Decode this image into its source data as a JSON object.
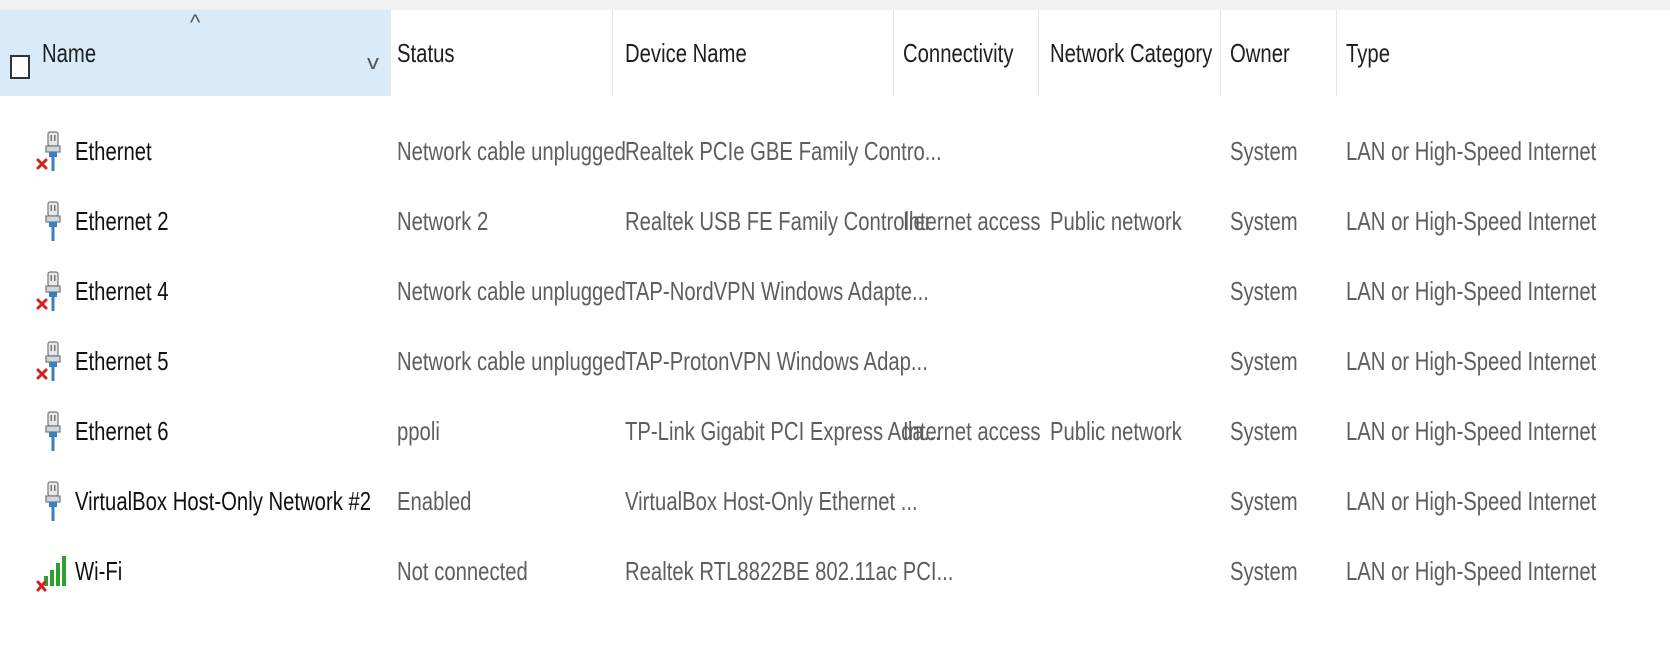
{
  "columns": {
    "name": "Name",
    "status": "Status",
    "device_name": "Device Name",
    "connectivity": "Connectivity",
    "network_category": "Network Category",
    "owner": "Owner",
    "type": "Type"
  },
  "sort_indicator": "^",
  "dropdown_indicator": "v",
  "rows": [
    {
      "name": "Ethernet",
      "status": "Network cable unplugged",
      "device_name": "Realtek PCIe GBE Family Contro...",
      "connectivity": "",
      "network_category": "",
      "owner": "System",
      "type": "LAN or High-Speed Internet",
      "icon": "ethernet-disconnected-icon"
    },
    {
      "name": "Ethernet 2",
      "status": "Network  2",
      "device_name": "Realtek USB FE Family Controller",
      "connectivity": "Internet access",
      "network_category": "Public network",
      "owner": "System",
      "type": "LAN or High-Speed Internet",
      "icon": "ethernet-icon"
    },
    {
      "name": "Ethernet 4",
      "status": "Network cable unplugged",
      "device_name": "TAP-NordVPN Windows Adapte...",
      "connectivity": "",
      "network_category": "",
      "owner": "System",
      "type": "LAN or High-Speed Internet",
      "icon": "ethernet-disconnected-icon"
    },
    {
      "name": "Ethernet 5",
      "status": "Network cable unplugged",
      "device_name": "TAP-ProtonVPN Windows Adap...",
      "connectivity": "",
      "network_category": "",
      "owner": "System",
      "type": "LAN or High-Speed Internet",
      "icon": "ethernet-disconnected-icon"
    },
    {
      "name": "Ethernet 6",
      "status": "ppoli",
      "device_name": "TP-Link Gigabit PCI Express Ada...",
      "connectivity": "Internet access",
      "network_category": "Public network",
      "owner": "System",
      "type": "LAN or High-Speed Internet",
      "icon": "ethernet-icon"
    },
    {
      "name": "VirtualBox Host-Only Network #2",
      "status": "Enabled",
      "device_name": "VirtualBox Host-Only Ethernet ...",
      "connectivity": "",
      "network_category": "",
      "owner": "System",
      "type": "LAN or High-Speed Internet",
      "icon": "ethernet-icon"
    },
    {
      "name": "Wi-Fi",
      "status": "Not connected",
      "device_name": "Realtek RTL8822BE 802.11ac PCI...",
      "connectivity": "",
      "network_category": "",
      "owner": "System",
      "type": "LAN or High-Speed Internet",
      "icon": "wifi-disconnected-icon"
    }
  ],
  "colors": {
    "header_selected": "#d9ebf9",
    "error_x": "#d42020",
    "plug_blue": "#3a7fc0",
    "wifi_green": "#2ea02e"
  }
}
